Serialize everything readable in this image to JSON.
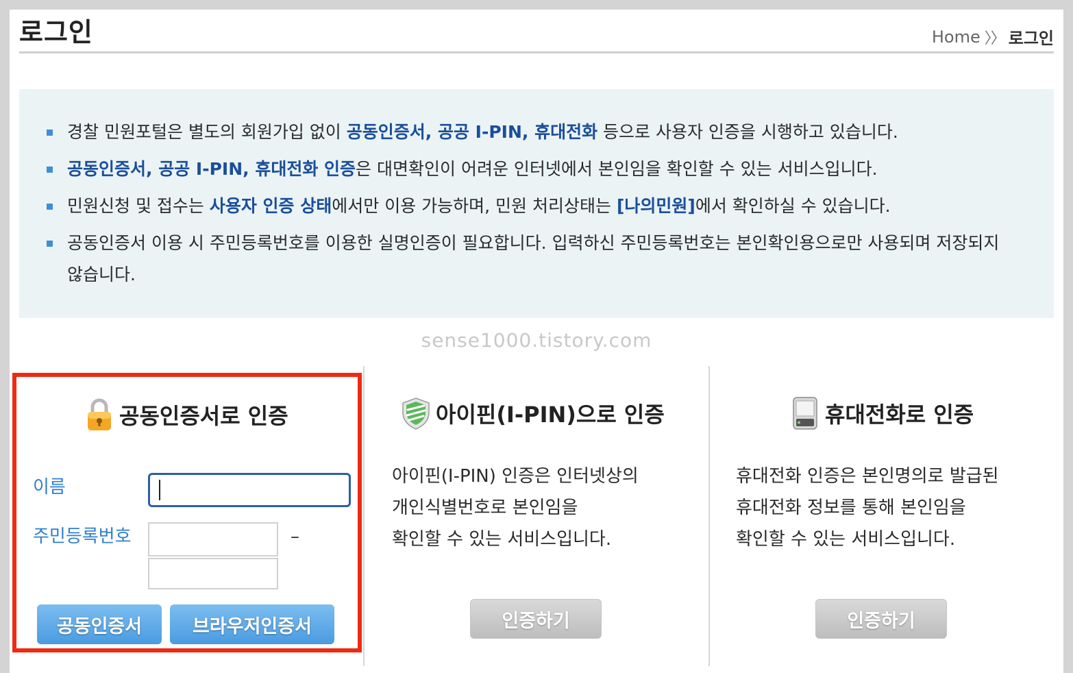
{
  "header": {
    "title": "로그인",
    "breadcrumb": {
      "home": "Home",
      "separator": "〉〉",
      "current": "로그인"
    }
  },
  "notice": {
    "items": [
      {
        "parts": [
          {
            "text": "경찰 민원포털은 별도의 회원가입 없이 ",
            "hl": false
          },
          {
            "text": "공동인증서, 공공 I-PIN, 휴대전화",
            "hl": true
          },
          {
            "text": " 등으로 사용자 인증을 시행하고 있습니다.",
            "hl": false
          }
        ]
      },
      {
        "parts": [
          {
            "text": "공동인증서, 공공 I-PIN, 휴대전화 인증",
            "hl": true
          },
          {
            "text": "은 대면확인이 어려운 인터넷에서 본인임을 확인할 수 있는 서비스입니다.",
            "hl": false
          }
        ]
      },
      {
        "parts": [
          {
            "text": "민원신청 및 접수는 ",
            "hl": false
          },
          {
            "text": "사용자 인증 상태",
            "hl": true
          },
          {
            "text": "에서만 이용 가능하며, 민원 처리상태는 ",
            "hl": false
          },
          {
            "text": "[나의민원]",
            "hl": true
          },
          {
            "text": "에서 확인하실 수 있습니다.",
            "hl": false
          }
        ]
      },
      {
        "parts": [
          {
            "text": "공동인증서 이용 시 주민등록번호를 이용한 실명인증이 필요합니다. 입력하신 주민등록번호는 본인확인용으로만 사용되며 저장되지 않습니다.",
            "hl": false
          }
        ]
      }
    ]
  },
  "watermark": "sense1000.tistory.com",
  "cert_panel": {
    "title": "공동인증서로 인증",
    "icon": "padlock-icon",
    "name_label": "이름",
    "name_value": "",
    "rrn_label": "주민등록번호",
    "rrn_front_value": "",
    "rrn_dash": "–",
    "rrn_back_value": "",
    "button_cert": "공동인증서",
    "button_browser": "브라우저인증서"
  },
  "ipin_panel": {
    "title": "아이핀(I-PIN)으로 인증",
    "icon": "shield-icon",
    "desc_lines": [
      "아이핀(I-PIN) 인증은 인터넷상의",
      "개인식별번호로 본인임을",
      "확인할 수 있는 서비스입니다."
    ],
    "button": "인증하기"
  },
  "phone_panel": {
    "title": "휴대전화로 인증",
    "icon": "mobile-phone-icon",
    "desc_lines": [
      "휴대전화 인증은 본인명의로 발급된",
      "휴대전화 정보를 통해 본인임을",
      "확인할 수 있는 서비스입니다."
    ],
    "button": "인증하기"
  },
  "colors": {
    "highlight": "#1a4e9a",
    "bullet": "#3d8fd6",
    "notice_bg": "#ebf3f5",
    "red_outline": "#f02a12",
    "label_blue": "#2f7fd0",
    "button_blue": "#4b9be0"
  }
}
